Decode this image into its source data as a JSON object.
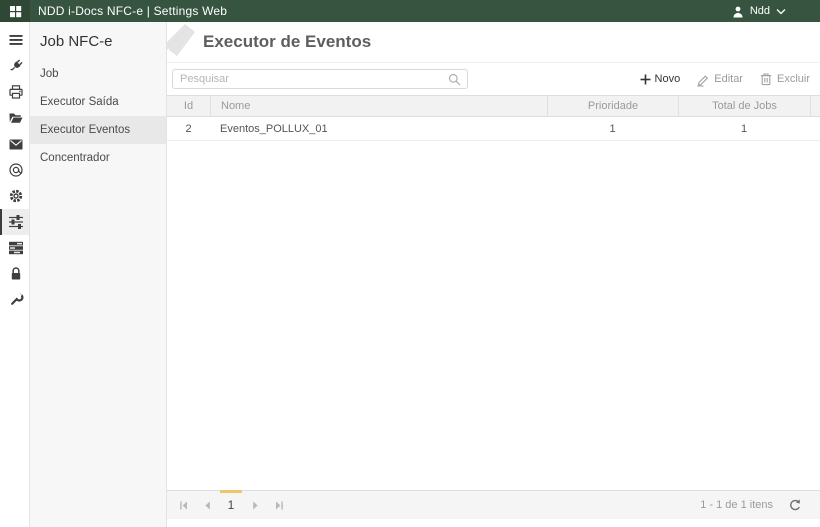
{
  "topbar": {
    "title": "NDD i-Docs NFC-e | Settings Web",
    "user_name": "Ndd",
    "bg_color": "#375440",
    "icons": [
      "apps-grid-icon",
      "user-icon",
      "chevron-down-icon"
    ]
  },
  "icon_rail": {
    "selected_index": 7,
    "items": [
      {
        "icon": "menu-icon"
      },
      {
        "icon": "plug-icon"
      },
      {
        "icon": "printer-icon"
      },
      {
        "icon": "folder-open-icon"
      },
      {
        "icon": "mail-icon"
      },
      {
        "icon": "at-sign-icon"
      },
      {
        "icon": "gear-icon"
      },
      {
        "icon": "sliders-icon",
        "selected": true
      },
      {
        "icon": "queue-icon"
      },
      {
        "icon": "lock-icon"
      },
      {
        "icon": "wrench-icon"
      }
    ]
  },
  "subnav": {
    "title": "Job NFC-e",
    "items": [
      {
        "label": "Job",
        "selected": false
      },
      {
        "label": "Executor Saída",
        "selected": false
      },
      {
        "label": "Executor Eventos",
        "selected": true
      },
      {
        "label": "Concentrador",
        "selected": false
      }
    ]
  },
  "page": {
    "title": "Executor de Eventos"
  },
  "toolbar": {
    "search_placeholder": "Pesquisar",
    "search_value": "",
    "buttons": [
      {
        "label": "Novo",
        "icon": "plus-icon",
        "enabled": true
      },
      {
        "label": "Editar",
        "icon": "edit-icon",
        "enabled": false
      },
      {
        "label": "Excluir",
        "icon": "trash-icon",
        "enabled": false
      }
    ]
  },
  "grid": {
    "columns": [
      "Id",
      "Nome",
      "Prioridade",
      "Total de Jobs"
    ],
    "rows": [
      [
        "2",
        "Eventos_POLLUX_01",
        "1",
        "1"
      ]
    ]
  },
  "pager": {
    "current_page": "1",
    "info": "1 - 1 de 1 itens",
    "accent_color": "#e9c76a"
  },
  "colors": {
    "topbar_green": "#375440",
    "topbar_button_green": "#2f4836",
    "selected_page_indicator": "#e9c76a",
    "grid_header_bg": "#f2f2f2",
    "sidebar_bg": "#f7f7f7"
  }
}
